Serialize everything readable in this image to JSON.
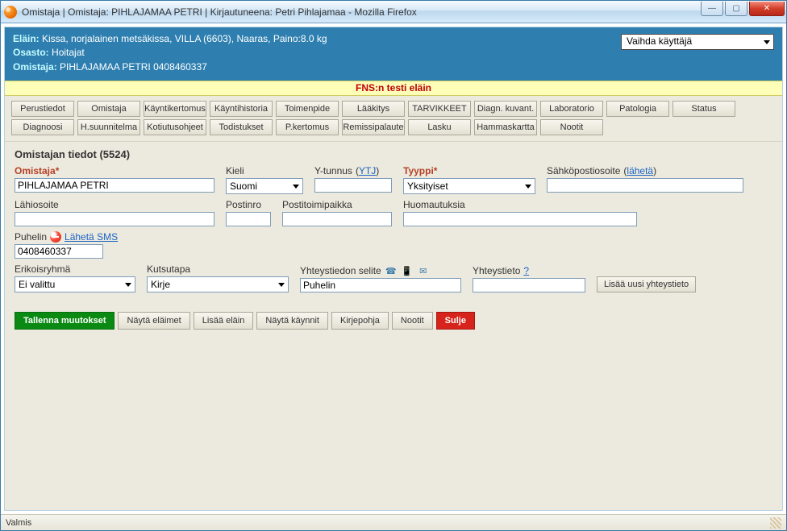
{
  "window": {
    "title": "Omistaja | Omistaja: PIHLAJAMAA PETRI | Kirjautuneena: Petri Pihlajamaa - Mozilla Firefox"
  },
  "header": {
    "elain_label": "Eläin:",
    "elain_value": "Kissa, norjalainen metsäkissa, VILLA (6603), Naaras, Paino:8.0 kg",
    "osasto_label": "Osasto:",
    "osasto_value": "Hoitajat",
    "omistaja_label": "Omistaja:",
    "omistaja_value": "PIHLAJAMAA PETRI 0408460337",
    "user_switch": "Vaihda käyttäjä"
  },
  "banner": "FNS:n testi eläin",
  "nav": {
    "row1": [
      "Perustiedot",
      "Omistaja",
      "Käyntikertomus",
      "Käyntihistoria",
      "Toimenpide",
      "Lääkitys",
      "TARVIKKEET",
      "Diagn. kuvant.",
      "Laboratorio",
      "Patologia",
      "Status"
    ],
    "row2": [
      "Diagnoosi",
      "H.suunnitelma",
      "Kotiutusohjeet",
      "Todistukset",
      "P.kertomus",
      "Remissipalaute",
      "Lasku",
      "Hammaskartta",
      "Nootit"
    ]
  },
  "section": {
    "title": "Omistajan tiedot (5524)"
  },
  "form": {
    "omistaja": {
      "label": "Omistaja*",
      "value": "PIHLAJAMAA PETRI"
    },
    "kieli": {
      "label": "Kieli",
      "value": "Suomi"
    },
    "ytunnus": {
      "label": "Y-tunnus",
      "link": "YTJ",
      "value": ""
    },
    "tyyppi": {
      "label": "Tyyppi*",
      "value": "Yksityiset"
    },
    "sahkoposti": {
      "label": "Sähköpostiosoite",
      "link": "lähetä",
      "value": ""
    },
    "lahiosoite": {
      "label": "Lähiosoite",
      "value": ""
    },
    "postinro": {
      "label": "Postinro",
      "value": ""
    },
    "postitoimipaikka": {
      "label": "Postitoimipaikka",
      "value": ""
    },
    "huomautuksia": {
      "label": "Huomautuksia",
      "value": ""
    },
    "puhelin": {
      "label": "Puhelin",
      "link": "Lähetä SMS",
      "value": "0408460337"
    },
    "erikoisryhma": {
      "label": "Erikoisryhmä",
      "value": "Ei valittu"
    },
    "kutsutapa": {
      "label": "Kutsutapa",
      "value": "Kirje"
    },
    "yhteystiedon_selite": {
      "label": "Yhteystiedon selite",
      "value": "Puhelin"
    },
    "yhteystieto": {
      "label": "Yhteystieto",
      "help": "?",
      "value": ""
    },
    "lisaa_uusi_yhteystieto": "Lisää uusi yhteystieto"
  },
  "actions": {
    "tallenna": "Tallenna muutokset",
    "nayta_elaimet": "Näytä eläimet",
    "lisaa_elain": "Lisää eläin",
    "nayta_kaynnit": "Näytä käynnit",
    "kirjepohja": "Kirjepohja",
    "nootit": "Nootit",
    "sulje": "Sulje"
  },
  "statusbar": {
    "text": "Valmis"
  }
}
